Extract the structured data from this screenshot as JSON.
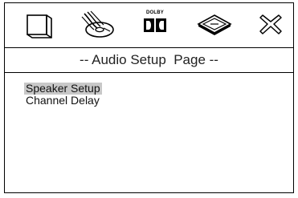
{
  "icons": [
    {
      "name": "tv-screen-icon"
    },
    {
      "name": "audio-disc-icon"
    },
    {
      "name": "dolby-icon",
      "label": "DOLBY"
    },
    {
      "name": "video-setup-icon"
    },
    {
      "name": "exit-icon"
    }
  ],
  "page": {
    "title": "-- Audio Setup  Page --"
  },
  "menu": {
    "items": [
      {
        "label": "Speaker Setup",
        "selected": true
      },
      {
        "label": "Channel Delay",
        "selected": false
      }
    ]
  },
  "colors": {
    "selection_bg": "#c8c8c8",
    "border": "#000000"
  }
}
